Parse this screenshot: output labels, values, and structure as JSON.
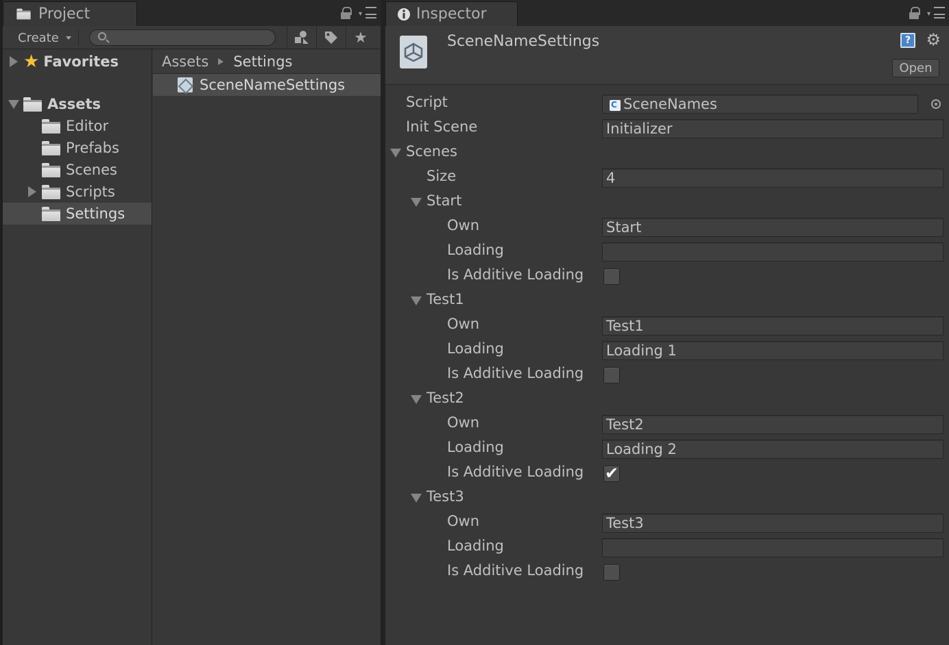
{
  "project": {
    "tab_label": "Project",
    "create_label": "Create",
    "search_placeholder": "",
    "tree": {
      "favorites": "Favorites",
      "assets": "Assets",
      "folders": [
        "Editor",
        "Prefabs",
        "Scenes",
        "Scripts",
        "Settings"
      ]
    },
    "breadcrumb": [
      "Assets",
      "Settings"
    ],
    "files": [
      "SceneNameSettings"
    ]
  },
  "inspector": {
    "tab_label": "Inspector",
    "asset_title": "SceneNameSettings",
    "open_label": "Open",
    "script_label": "Script",
    "script_value": "SceneNames",
    "init_scene_label": "Init Scene",
    "init_scene_value": "Initializer",
    "scenes_label": "Scenes",
    "size_label": "Size",
    "size_value": "4",
    "field_labels": {
      "own": "Own",
      "loading": "Loading",
      "additive": "Is Additive Loading"
    },
    "scenes": [
      {
        "name": "Start",
        "own": "Start",
        "loading": "",
        "additive": false
      },
      {
        "name": "Test1",
        "own": "Test1",
        "loading": "Loading 1",
        "additive": false
      },
      {
        "name": "Test2",
        "own": "Test2",
        "loading": "Loading 2",
        "additive": true
      },
      {
        "name": "Test3",
        "own": "Test3",
        "loading": "",
        "additive": false
      }
    ]
  },
  "icons": {
    "project_tab": "folder-icon",
    "inspector_tab": "info-icon",
    "lock": "lock-icon",
    "menu": "panel-menu-icon",
    "search": "search-icon",
    "type_filter": "type-filter-icon",
    "label_filter": "label-icon",
    "favorite": "star-icon",
    "help": "help-icon",
    "settings": "gear-icon",
    "object_picker": "object-picker-icon"
  }
}
